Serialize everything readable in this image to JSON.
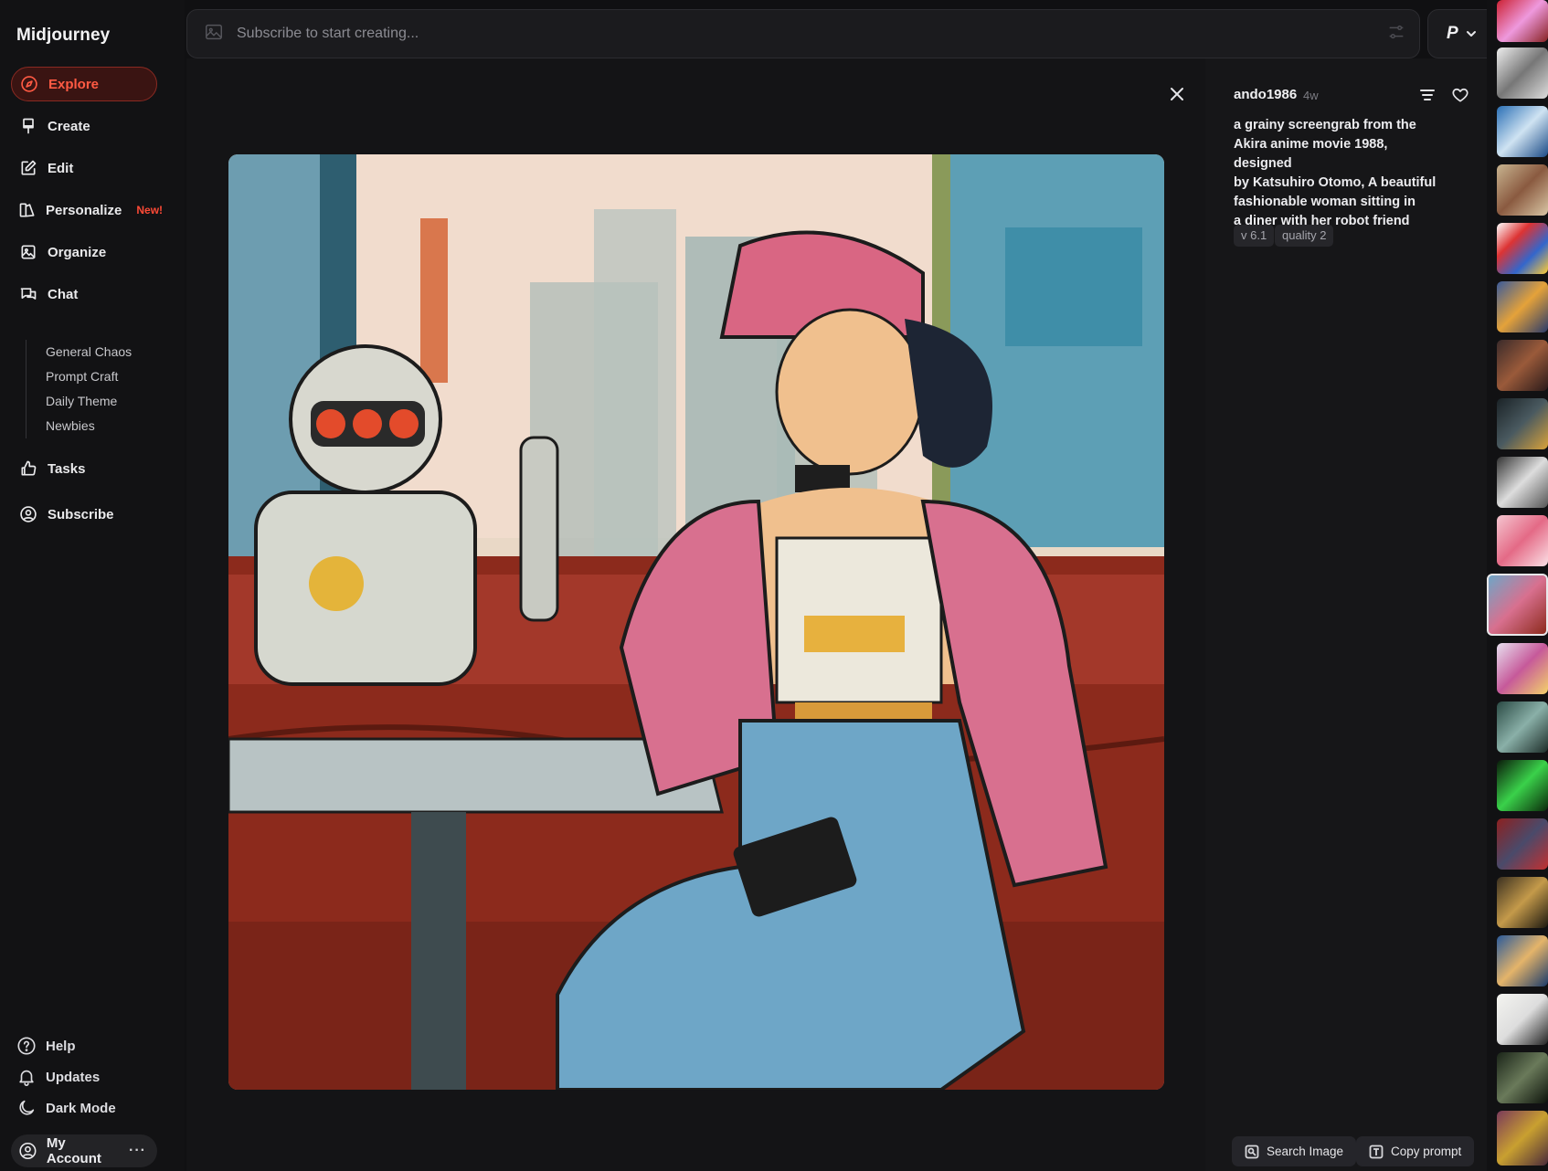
{
  "app": {
    "title": "Midjourney"
  },
  "sidebar": {
    "items": [
      {
        "label": "Explore",
        "icon": "compass-icon",
        "active": true
      },
      {
        "label": "Create",
        "icon": "paintbrush-icon"
      },
      {
        "label": "Edit",
        "icon": "edit-icon"
      },
      {
        "label": "Personalize",
        "icon": "personalize-icon",
        "badge": "New!"
      },
      {
        "label": "Organize",
        "icon": "image-folder-icon"
      },
      {
        "label": "Chat",
        "icon": "chat-icon"
      },
      {
        "label": "Tasks",
        "icon": "thumbs-up-icon"
      },
      {
        "label": "Subscribe",
        "icon": "user-circle-icon"
      }
    ],
    "chat_channels": [
      "General Chaos",
      "Prompt Craft",
      "Daily Theme",
      "Newbies"
    ],
    "bottom": {
      "help": "Help",
      "updates": "Updates",
      "dark_mode": "Dark Mode",
      "account": "My Account",
      "more": "···"
    }
  },
  "topbar": {
    "placeholder": "Subscribe to start creating...",
    "profile_letter": "P"
  },
  "post": {
    "author": "ando1986",
    "age": "4w",
    "prompt_lines": [
      "a grainy screengrab from the",
      "Akira anime movie 1988, designed",
      "by Katsuhiro Otomo, A beautiful",
      "fashionable woman sitting in",
      "a diner with her robot friend"
    ],
    "tags": [
      "v 6.1",
      "quality 2"
    ],
    "actions": {
      "search_image": "Search Image",
      "copy_prompt": "Copy prompt"
    }
  },
  "colors": {
    "accent": "#ff5a43",
    "background": "#101012",
    "panel": "#1b1b1e"
  }
}
